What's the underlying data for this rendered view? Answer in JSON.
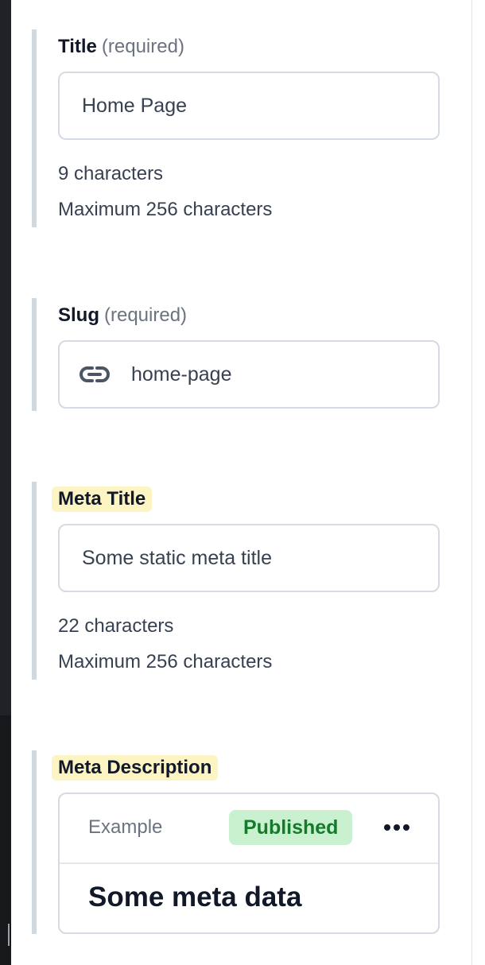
{
  "fields": {
    "title": {
      "label": "Title",
      "required": "(required)",
      "value": "Home Page",
      "count": "9 characters",
      "max": "Maximum 256 characters"
    },
    "slug": {
      "label": "Slug",
      "required": "(required)",
      "value": "home-page",
      "icon": "link-icon"
    },
    "meta_title": {
      "label": "Meta Title",
      "value": "Some static meta title",
      "count": "22 characters",
      "max": "Maximum 256 characters"
    },
    "meta_description": {
      "label": "Meta Description",
      "example": "Example",
      "status": "Published",
      "status_color": "#167a2c",
      "status_bg": "#c9f1cf",
      "content": "Some meta data"
    }
  },
  "colors": {
    "highlight": "#fdf4c4",
    "field_bar": "#d1d9e0"
  }
}
